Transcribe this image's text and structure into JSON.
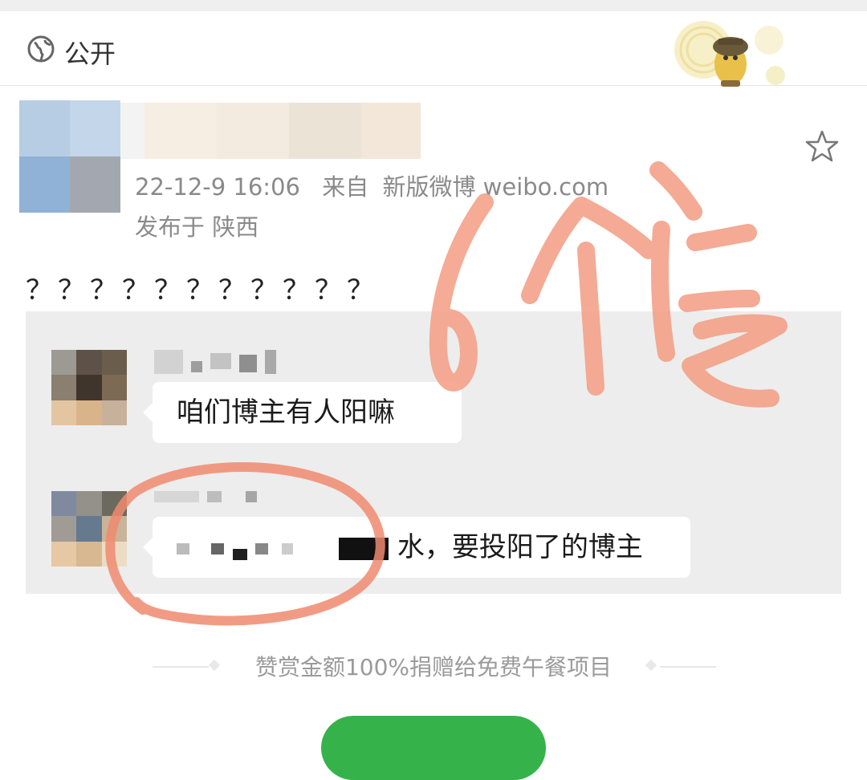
{
  "header": {
    "visibility_label": "公开",
    "visibility_icon": "globe-icon",
    "mascot_icon": "pikachu-detective-sticker"
  },
  "post": {
    "timestamp": "22-12-9 16:06",
    "source_prefix": "来自",
    "source_app": "新版微博 weibo.com",
    "location": "发布于 陕西",
    "text": "？？？？？？？？？？？",
    "favorite_icon": "star-icon"
  },
  "quoted_comments": [
    {
      "text": "咱们博主有人阳嘛"
    },
    {
      "text_visible_suffix": "水，要投阳了的博主"
    }
  ],
  "annotation": {
    "handwritten": "6个号",
    "color": "#f08a6e"
  },
  "reward": {
    "text": "赞赏金额100%捐赠给免费午餐项目"
  },
  "colors": {
    "accent_green": "#35b34a",
    "meta_gray": "#8a8a8a",
    "quote_bg": "#ededed"
  }
}
